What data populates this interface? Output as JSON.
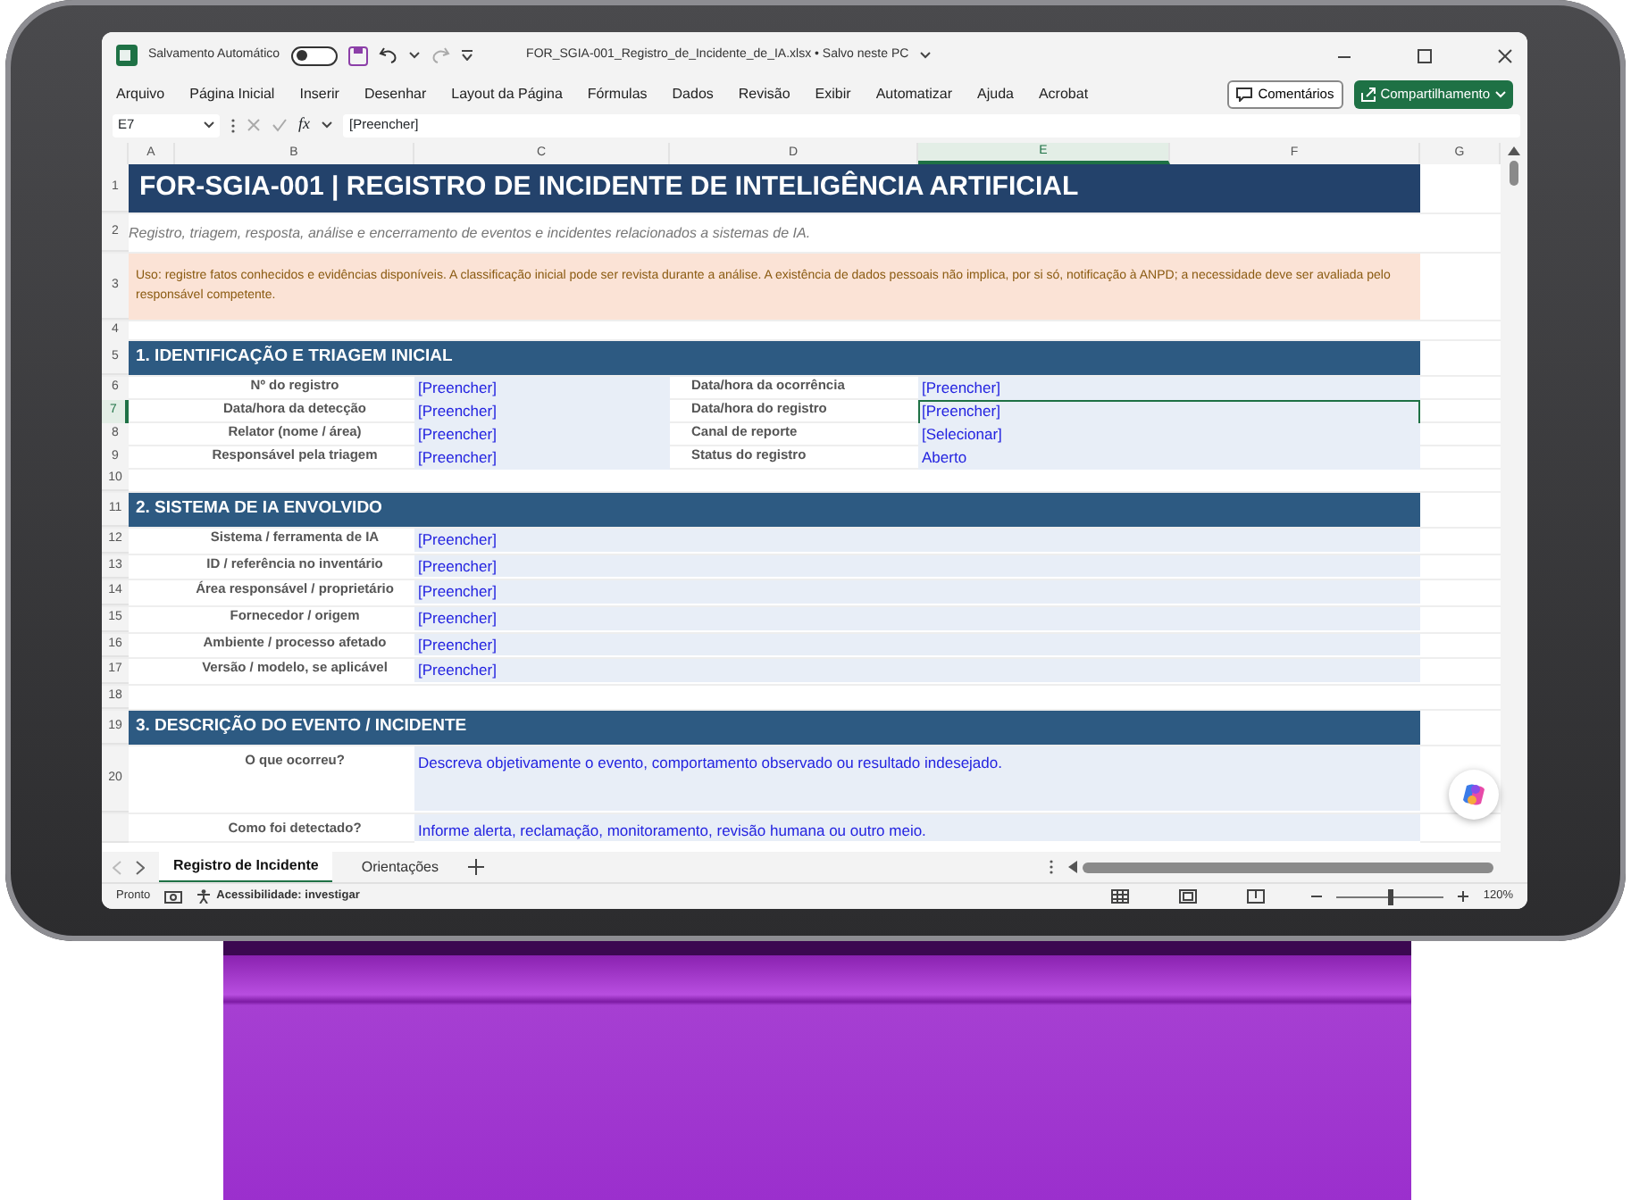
{
  "titlebar": {
    "autosave_label": "Salvamento Automático",
    "autosave_on": false,
    "filename": "FOR_SGIA-001_Registro_de_Incidente_de_IA.xlsx • Salvo neste PC"
  },
  "menu": [
    "Arquivo",
    "Página Inicial",
    "Inserir",
    "Desenhar",
    "Layout da Página",
    "Fórmulas",
    "Dados",
    "Revisão",
    "Exibir",
    "Automatizar",
    "Ajuda",
    "Acrobat"
  ],
  "comments_button": "Comentários",
  "share_button": "Compartilhamento",
  "formula_bar": {
    "name_box": "E7",
    "function_label": "fx",
    "formula": "[Preencher]"
  },
  "columns": [
    {
      "label": "A",
      "selected": false
    },
    {
      "label": "B",
      "selected": false
    },
    {
      "label": "C",
      "selected": false
    },
    {
      "label": "D",
      "selected": false
    },
    {
      "label": "E",
      "selected": true
    },
    {
      "label": "F",
      "selected": false
    },
    {
      "label": "G",
      "selected": false
    }
  ],
  "row_numbers": [
    {
      "label": "1",
      "selected": false
    },
    {
      "label": "2",
      "selected": false
    },
    {
      "label": "3",
      "selected": false
    },
    {
      "label": "4",
      "selected": false
    },
    {
      "label": "5",
      "selected": false
    },
    {
      "label": "6",
      "selected": false
    },
    {
      "label": "7",
      "selected": true
    },
    {
      "label": "8",
      "selected": false
    },
    {
      "label": "9",
      "selected": false
    },
    {
      "label": "10",
      "selected": false
    },
    {
      "label": "11",
      "selected": false
    },
    {
      "label": "12",
      "selected": false
    },
    {
      "label": "13",
      "selected": false
    },
    {
      "label": "14",
      "selected": false
    },
    {
      "label": "15",
      "selected": false
    },
    {
      "label": "16",
      "selected": false
    },
    {
      "label": "17",
      "selected": false
    },
    {
      "label": "18",
      "selected": false
    },
    {
      "label": "19",
      "selected": false
    },
    {
      "label": "20",
      "selected": false
    }
  ],
  "sheet": {
    "title": "FOR-SGIA-001 | REGISTRO DE INCIDENTE DE INTELIGÊNCIA ARTIFICIAL",
    "subtitle": "Registro, triagem, resposta, análise e encerramento de eventos e incidentes relacionados a sistemas de IA.",
    "notice": "Uso: registre fatos conhecidos e evidências disponíveis. A classificação inicial pode ser revista durante a análise. A existência de dados pessoais não implica, por si só, notificação à ANPD; a necessidade deve ser avaliada pelo responsável competente."
  },
  "sections": [
    {
      "title": "1. IDENTIFICAÇÃO E TRIAGEM INICIAL",
      "kind": "paired",
      "fields": [
        {
          "label": "Nº do registro",
          "value": "[Preencher]",
          "selected": false
        },
        {
          "label": "Data/hora da ocorrência",
          "value": "[Preencher]",
          "selected": false
        },
        {
          "label": "Data/hora da detecção",
          "value": "[Preencher]",
          "selected": false
        },
        {
          "label": "Data/hora do registro",
          "value": "[Preencher]",
          "selected": true
        },
        {
          "label": "Relator (nome / área)",
          "value": "[Preencher]",
          "selected": false
        },
        {
          "label": "Canal de reporte",
          "value": "[Selecionar]",
          "selected": false
        },
        {
          "label": "Responsável pela triagem",
          "value": "[Preencher]",
          "selected": false
        },
        {
          "label": "Status do registro",
          "value": "Aberto",
          "selected": false
        }
      ]
    },
    {
      "title": "2. SISTEMA DE IA ENVOLVIDO",
      "kind": "wide",
      "fields": [
        {
          "label": "Sistema / ferramenta de IA",
          "value": "[Preencher]",
          "selected": false
        },
        {
          "label": "ID / referência no inventário",
          "value": "[Preencher]",
          "selected": false
        },
        {
          "label": "Área responsável / proprietário",
          "value": "[Preencher]",
          "selected": false
        },
        {
          "label": "Fornecedor / origem",
          "value": "[Preencher]",
          "selected": false
        },
        {
          "label": "Ambiente / processo afetado",
          "value": "[Preencher]",
          "selected": false
        },
        {
          "label": "Versão / modelo, se aplicável",
          "value": "[Preencher]",
          "selected": false
        }
      ]
    },
    {
      "title": "3. DESCRIÇÃO DO EVENTO / INCIDENTE",
      "kind": "long",
      "fields": [
        {
          "label": "O que ocorreu?",
          "value": "Descreva objetivamente o evento, comportamento observado ou resultado indesejado.",
          "selected": false
        },
        {
          "label": "Como foi detectado?",
          "value": "Informe alerta, reclamação, monitoramento, revisão humana ou outro meio.",
          "selected": false
        }
      ]
    }
  ],
  "sheet_tabs": [
    {
      "label": "Registro de Incidente",
      "selected": true
    },
    {
      "label": "Orientações",
      "selected": false
    }
  ],
  "status_bar": {
    "ready": "Pronto",
    "accessibility": "Acessibilidade: investigar",
    "zoom_slider": {
      "level": 0.5
    },
    "zoom": "120%"
  }
}
